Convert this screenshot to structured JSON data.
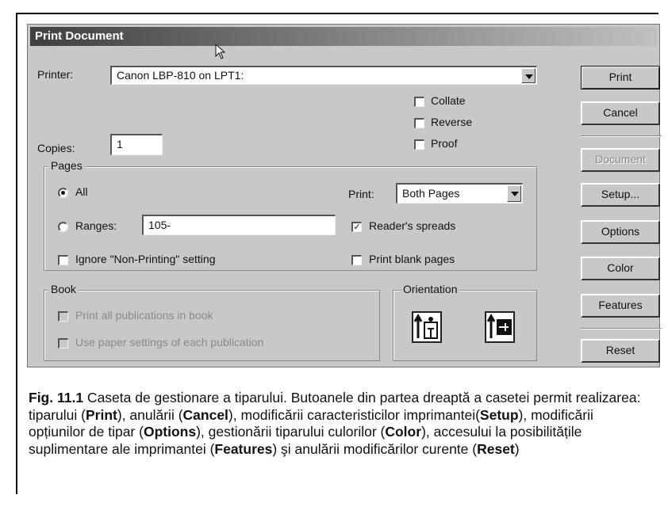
{
  "dialog": {
    "title": "Print Document",
    "printer_label": "Printer:",
    "printer_value": "Canon LBP-810 on LPT1:",
    "copies_label": "Copies:",
    "copies_value": "1",
    "collate": {
      "label": "Collate",
      "checked": false
    },
    "reverse": {
      "label": "Reverse",
      "checked": false
    },
    "proof": {
      "label": "Proof",
      "checked": false
    },
    "pages": {
      "title": "Pages",
      "all_label": "All",
      "all_selected": true,
      "ranges_label": "Ranges:",
      "ranges_value": "105-",
      "ignore_label": "Ignore \"Non-Printing\" setting",
      "ignore_checked": false,
      "print_label": "Print:",
      "print_value": "Both Pages",
      "readers_label": "Reader's spreads",
      "readers_checked": true,
      "blank_label": "Print blank pages",
      "blank_checked": false
    },
    "book": {
      "title": "Book",
      "print_all_label": "Print all publications in book",
      "paper_settings_label": "Use paper settings of each publication"
    },
    "orientation": {
      "title": "Orientation"
    },
    "buttons": {
      "print": "Print",
      "cancel": "Cancel",
      "document": "Document",
      "setup": "Setup...",
      "options": "Options",
      "color": "Color",
      "features": "Features",
      "reset": "Reset"
    }
  },
  "caption": {
    "fig": "Fig. 11.1",
    "t1": " Caseta de gestionare a tiparului. Butoanele din partea dreaptă a casetei permit realizarea: tiparului (",
    "b1": "Print",
    "t2": "), anulării (",
    "b2": "Cancel",
    "t3": "), modificării caracteristicilor imprimantei(",
    "b3": "Setup",
    "t4": "), modificării opțiunilor de tipar (",
    "b4": "Options",
    "t5": "), gestionării  tiparului culorilor (",
    "b5": "Color",
    "t6": "), accesului la posibilitățile suplimentare ale imprimantei (",
    "b6": "Features",
    "t7": ") şi anulării modificărilor curente (",
    "b7": "Reset",
    "t8": ")"
  }
}
